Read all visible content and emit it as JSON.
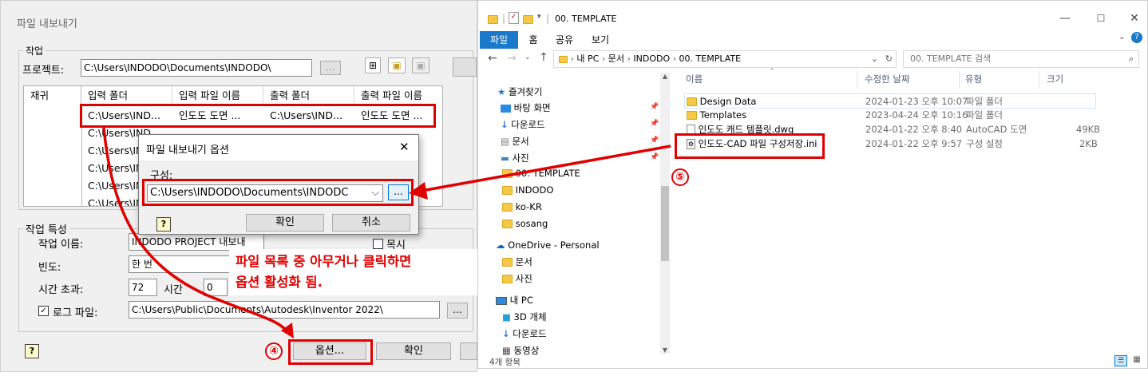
{
  "export_dialog": {
    "title": "파일 내보내기",
    "task_group": "작업",
    "project_label": "프로젝트:",
    "project_path": "C:\\Users\\INDODO\\Documents\\INDODO\\",
    "browse": "...",
    "grid": {
      "columns": [
        "재귀",
        "입력 폴더",
        "입력 파일 이름",
        "출력 폴더",
        "출력 파일 이름"
      ],
      "first_row": [
        "",
        "C:\\Users\\IND...",
        "인도도 도면 ...",
        "C:\\Users\\IND...",
        "인도도 도면 ..."
      ],
      "rows_peek": [
        "C:\\Users\\IND...",
        "C:\\Users\\IND...",
        "C:\\Users\\IND...",
        "C:\\Users\\IND...",
        "C:\\Users\\IND..."
      ]
    },
    "props_group": "작업 특성",
    "task_name_label": "작업 이름:",
    "task_name_value": "INDODO PROJECT 내보내",
    "checkbox_peek": "목시",
    "frequency_label": "빈도:",
    "frequency_value": "한 번",
    "timeout_label": "시간 초과:",
    "timeout_value": "72",
    "timeout_unit": "시간",
    "timeout_minutes": "0",
    "log_label": "로그 파일:",
    "log_path": "C:\\Users\\Public\\Documents\\Autodesk\\Inventor 2022\\",
    "help": "?",
    "options_button": "옵션...",
    "ok_button": "확인"
  },
  "options_modal": {
    "title": "파일 내보내기 옵션",
    "close": "✕",
    "config_label": "구성:",
    "config_value": "C:\\Users\\INDODO\\Documents\\INDODC",
    "browse": "...",
    "ok": "확인",
    "cancel": "취소",
    "help": "?"
  },
  "annotations": {
    "step4": "④",
    "step5": "⑤",
    "note_line1": "파일 목록 중 아무거나 클릭하면",
    "note_line2": "옵션 활성화 됨."
  },
  "explorer": {
    "title": "00. TEMPLATE",
    "ribbon_tabs": [
      "파일",
      "홈",
      "공유",
      "보기"
    ],
    "breadcrumb": [
      "내 PC",
      "문서",
      "INDODO",
      "00. TEMPLATE"
    ],
    "search_placeholder": "00. TEMPLATE 검색",
    "nav": {
      "quick_access": "즐겨찾기",
      "desktop": "바탕 화면",
      "downloads": "다운로드",
      "documents": "문서",
      "pictures": "사진",
      "template": "00. TEMPLATE",
      "indodo": "INDODO",
      "kokr": "ko-KR",
      "sosang": "sosang",
      "onedrive": "OneDrive - Personal",
      "od_documents": "문서",
      "od_pictures": "사진",
      "this_pc": "내 PC",
      "objects3d": "3D 개체",
      "pc_downloads": "다운로드",
      "videos": "동영상"
    },
    "columns": {
      "name": "이름",
      "modified": "수정한 날짜",
      "type": "유형",
      "size": "크기"
    },
    "files": [
      {
        "name": "Design Data",
        "date": "2024-01-23 오후 10:07",
        "type": "파일 폴더",
        "size": ""
      },
      {
        "name": "Templates",
        "date": "2023-04-24 오후 10:16",
        "type": "파일 폴더",
        "size": ""
      },
      {
        "name": "인도도 캐드 템플릿.dwg",
        "date": "2024-01-22 오후 8:40",
        "type": "AutoCAD 도면",
        "size": "49KB"
      },
      {
        "name": "인도도-CAD 파일 구성저장.ini",
        "date": "2024-01-22 오후 9:57",
        "type": "구성 설정",
        "size": "2KB"
      }
    ],
    "status": "4개 항목",
    "colors": {
      "ribbon_file": "#1979ca",
      "accent": "#e00000"
    }
  }
}
